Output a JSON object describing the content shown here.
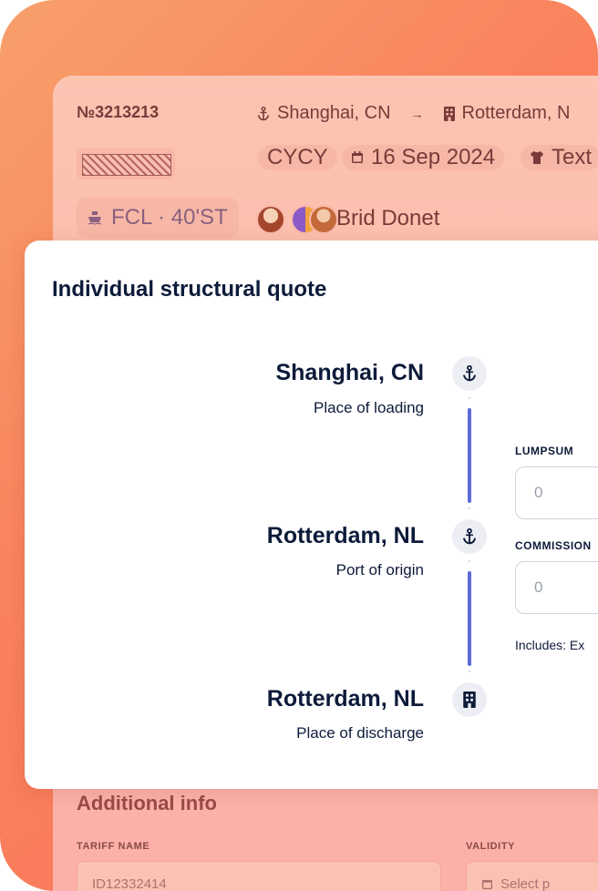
{
  "order": {
    "id": "№3213213",
    "origin": "Shanghai, CN",
    "destination": "Rotterdam, N",
    "chips": {
      "code": "CYCY",
      "date": "16 Sep 2024",
      "cargo": "Text"
    },
    "mode": "FCL · 40'ST",
    "assignee": "Brid Donet"
  },
  "modal": {
    "title": "Individual structural quote",
    "stops": [
      {
        "name": "Shanghai, CN",
        "role": "Place of loading",
        "icon": "anchor-icon"
      },
      {
        "name": "Rotterdam, NL",
        "role": "Port of origin",
        "icon": "anchor-icon"
      },
      {
        "name": "Rotterdam, NL",
        "role": "Place of discharge",
        "icon": "building-icon"
      }
    ],
    "lumpsum": {
      "label": "LUMPSUM",
      "placeholder": "0"
    },
    "commission": {
      "label": "COMMISSION",
      "placeholder": "0"
    },
    "includes": "Includes: Ex"
  },
  "additional": {
    "title": "Additional info",
    "tariff_label": "TARIFF NAME",
    "tariff_value": "ID12332414",
    "validity_label": "VALIDITY",
    "validity_placeholder": "Select p"
  },
  "colors": {
    "accent": "#5b6ad6",
    "text_dark": "#0d1b3a",
    "brand_orange": "#f9835d"
  }
}
